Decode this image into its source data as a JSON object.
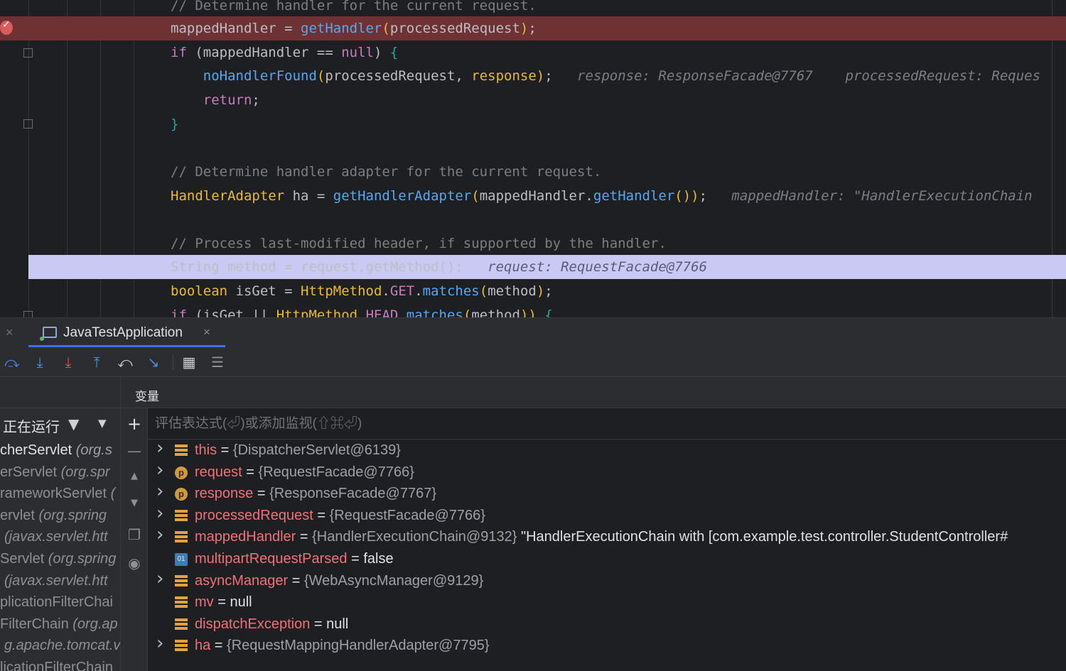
{
  "editor": {
    "lines": [
      {
        "id": "l0",
        "tokens": [
          {
            "c": "c-comment",
            "t": "// Determine handler for the current request."
          }
        ]
      },
      {
        "id": "l1",
        "tokens": [
          {
            "c": "c-plain",
            "t": "mappedHandler = "
          },
          {
            "c": "c-fn",
            "t": "getHandler"
          },
          {
            "c": "c-param",
            "t": "("
          },
          {
            "c": "c-plain",
            "t": "processedRequest"
          },
          {
            "c": "c-param",
            "t": ")"
          },
          {
            "c": "c-plain",
            "t": ";"
          }
        ]
      },
      {
        "id": "l2",
        "tokens": [
          {
            "c": "c-kw2",
            "t": "if"
          },
          {
            "c": "c-plain",
            "t": " (mappedHandler == "
          },
          {
            "c": "c-kw2",
            "t": "null"
          },
          {
            "c": "c-plain",
            "t": ") "
          },
          {
            "c": "c-brace",
            "t": "{"
          }
        ]
      },
      {
        "id": "l3",
        "tokens": [
          {
            "c": "c-plain",
            "t": "    "
          },
          {
            "c": "c-fn",
            "t": "noHandlerFound"
          },
          {
            "c": "c-param",
            "t": "("
          },
          {
            "c": "c-plain",
            "t": "processedRequest, "
          },
          {
            "c": "c-param",
            "t": "response"
          },
          {
            "c": "c-param",
            "t": ")"
          },
          {
            "c": "c-plain",
            "t": ";   "
          },
          {
            "c": "hint",
            "t": "response: ResponseFacade@7767    processedRequest: Reques"
          }
        ]
      },
      {
        "id": "l4",
        "tokens": [
          {
            "c": "c-plain",
            "t": "    "
          },
          {
            "c": "c-kw2",
            "t": "return"
          },
          {
            "c": "c-plain",
            "t": ";"
          }
        ]
      },
      {
        "id": "l5",
        "tokens": [
          {
            "c": "c-brace",
            "t": "}"
          }
        ]
      },
      {
        "id": "l6",
        "tokens": []
      },
      {
        "id": "l7",
        "tokens": [
          {
            "c": "c-comment",
            "t": "// Determine handler adapter for the current request."
          }
        ]
      },
      {
        "id": "l8",
        "tokens": [
          {
            "c": "c-type",
            "t": "HandlerAdapter"
          },
          {
            "c": "c-plain",
            "t": " ha = "
          },
          {
            "c": "c-fn",
            "t": "getHandlerAdapter"
          },
          {
            "c": "c-param",
            "t": "("
          },
          {
            "c": "c-plain",
            "t": "mappedHandler."
          },
          {
            "c": "c-fn",
            "t": "getHandler"
          },
          {
            "c": "c-param",
            "t": "()"
          },
          {
            "c": "c-param",
            "t": ")"
          },
          {
            "c": "c-plain",
            "t": ";   "
          },
          {
            "c": "hint",
            "t": "mappedHandler: \"HandlerExecutionChain"
          }
        ]
      },
      {
        "id": "l9",
        "tokens": []
      },
      {
        "id": "l10",
        "tokens": [
          {
            "c": "c-comment",
            "t": "// Process last-modified header, if supported by the handler."
          }
        ]
      },
      {
        "id": "l11",
        "tokens": [
          {
            "c": "c-plain",
            "t": "String method = request.getMethod();   "
          },
          {
            "c": "hint",
            "t": "request: RequestFacade@7766"
          }
        ]
      },
      {
        "id": "l12",
        "tokens": [
          {
            "c": "c-type",
            "t": "boolean"
          },
          {
            "c": "c-plain",
            "t": " isGet = "
          },
          {
            "c": "c-type",
            "t": "HttpMethod"
          },
          {
            "c": "c-plain",
            "t": "."
          },
          {
            "c": "c-field",
            "t": "GET"
          },
          {
            "c": "c-plain",
            "t": "."
          },
          {
            "c": "c-fn",
            "t": "matches"
          },
          {
            "c": "c-param",
            "t": "("
          },
          {
            "c": "c-plain",
            "t": "method"
          },
          {
            "c": "c-param",
            "t": ")"
          },
          {
            "c": "c-plain",
            "t": ";"
          }
        ]
      },
      {
        "id": "l13",
        "tokens": [
          {
            "c": "c-kw2",
            "t": "if"
          },
          {
            "c": "c-plain",
            "t": " (isGet || "
          },
          {
            "c": "c-type",
            "t": "HttpMethod"
          },
          {
            "c": "c-plain",
            "t": "."
          },
          {
            "c": "c-field",
            "t": "HEAD"
          },
          {
            "c": "c-plain",
            "t": "."
          },
          {
            "c": "c-fn",
            "t": "matches"
          },
          {
            "c": "c-param",
            "t": "("
          },
          {
            "c": "c-plain",
            "t": "method"
          },
          {
            "c": "c-param",
            "t": "))"
          },
          {
            "c": "c-plain",
            "t": " "
          },
          {
            "c": "c-brace",
            "t": "{"
          }
        ]
      }
    ]
  },
  "tab": {
    "label": "JavaTestApplication",
    "close": "×"
  },
  "left_close": "×",
  "toolbar": {
    "buttons": [
      {
        "name": "step-over-icon",
        "glyph": "⤼",
        "color": "#4a90e2"
      },
      {
        "name": "step-into-icon",
        "glyph": "⤓",
        "color": "#4a90e2"
      },
      {
        "name": "force-step-into-icon",
        "glyph": "⤓",
        "color": "#e05252"
      },
      {
        "name": "step-out-icon",
        "glyph": "⤒",
        "color": "#4a90e2"
      },
      {
        "name": "drop-frame-icon",
        "glyph": "⤺",
        "color": "#ced0d6"
      },
      {
        "name": "run-to-cursor-icon",
        "glyph": "↘",
        "color": "#4a90e2"
      },
      {
        "name": "evaluate-expression-icon",
        "glyph": "▦",
        "color": "#ced0d6"
      },
      {
        "name": "trace-current-stream-icon",
        "glyph": "☰",
        "color": "#8c8f94"
      }
    ]
  },
  "frames": {
    "filter_label": "正在运行",
    "filter_icon": "funnel-icon",
    "dropdown_icon": "triangle-down-icon",
    "items": [
      {
        "method": "cherServlet",
        "pkg": " (org.s",
        "dim": false
      },
      {
        "method": "erServlet",
        "pkg": " (org.spr",
        "dim": true
      },
      {
        "method": "rameworkServlet",
        "pkg": " (",
        "dim": true
      },
      {
        "method": "ervlet",
        "pkg": " (org.spring",
        "dim": true
      },
      {
        "method": "",
        "pkg": " (javax.servlet.htt",
        "dim": true
      },
      {
        "method": "Servlet",
        "pkg": " (org.spring",
        "dim": true
      },
      {
        "method": "",
        "pkg": " (javax.servlet.htt",
        "dim": true
      },
      {
        "method": "plicationFilterChai",
        "pkg": "",
        "dim": true
      },
      {
        "method": "FilterChain",
        "pkg": " (org.ap",
        "dim": true
      },
      {
        "method": "",
        "pkg": "g.apache.tomcat.v",
        "dim": true
      },
      {
        "method": "licationFilterChain",
        "pkg": "",
        "dim": true
      }
    ]
  },
  "variables": {
    "title": "变量",
    "eval_placeholder": "评估表达式(⏎)或添加监视(⇧⌘⏎)",
    "side_tools": [
      {
        "name": "add-watch-icon",
        "glyph": "+"
      },
      {
        "name": "remove-watch-icon",
        "glyph": "—"
      },
      {
        "name": "move-up-icon",
        "glyph": "▲"
      },
      {
        "name": "move-down-icon",
        "glyph": "▼"
      },
      {
        "name": "copy-icon",
        "glyph": "❐"
      },
      {
        "name": "view-options-icon",
        "glyph": "◉"
      }
    ],
    "rows": [
      {
        "expand": true,
        "icon": "field",
        "name": "this",
        "eq": " = ",
        "value": "{DispatcherServlet@6139}",
        "extra": ""
      },
      {
        "expand": true,
        "icon": "param",
        "name": "request",
        "eq": " = ",
        "value": "{RequestFacade@7766}",
        "extra": ""
      },
      {
        "expand": true,
        "icon": "param",
        "name": "response",
        "eq": " = ",
        "value": "{ResponseFacade@7767}",
        "extra": ""
      },
      {
        "expand": true,
        "icon": "field",
        "name": "processedRequest",
        "eq": " = ",
        "value": "{RequestFacade@7766}",
        "extra": ""
      },
      {
        "expand": true,
        "icon": "field",
        "name": "mappedHandler",
        "eq": " = ",
        "value": "{HandlerExecutionChain@9132}",
        "extra": " \"HandlerExecutionChain with [com.example.test.controller.StudentController#"
      },
      {
        "expand": false,
        "icon": "bool",
        "name": "multipartRequestParsed",
        "eq": " = ",
        "value": "false",
        "extra": ""
      },
      {
        "expand": true,
        "icon": "field",
        "name": "asyncManager",
        "eq": " = ",
        "value": "{WebAsyncManager@9129}",
        "extra": ""
      },
      {
        "expand": false,
        "icon": "field",
        "name": "mv",
        "eq": " = ",
        "value": "null",
        "extra": ""
      },
      {
        "expand": false,
        "icon": "field",
        "name": "dispatchException",
        "eq": " = ",
        "value": "null",
        "extra": ""
      },
      {
        "expand": true,
        "icon": "field",
        "name": "ha",
        "eq": " = ",
        "value": "{RequestMappingHandlerAdapter@7795}",
        "extra": ""
      }
    ]
  },
  "colors": {
    "breakpoint_line": "#6e3234",
    "execution_line": "#c9c9f4",
    "accent": "#3574f0"
  }
}
